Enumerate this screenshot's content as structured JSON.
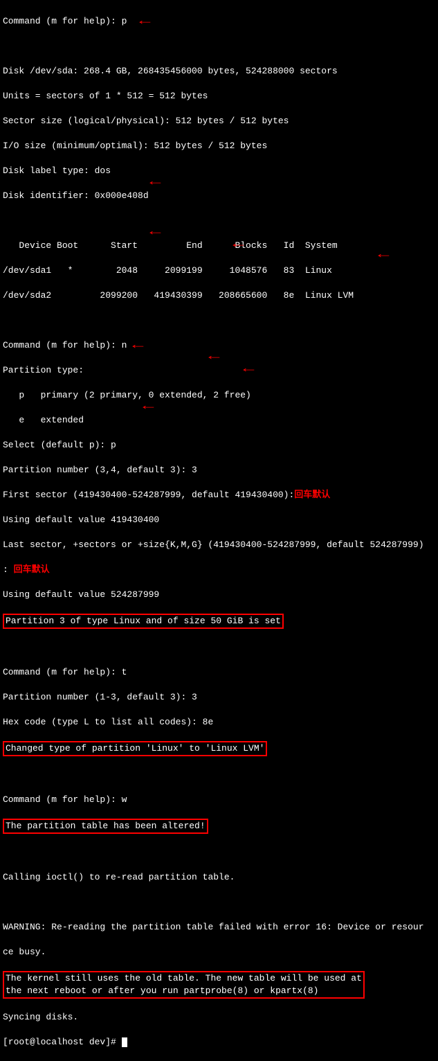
{
  "prompts": {
    "cmd": "Command (m for help): ",
    "root": "[root@localhost dev]# "
  },
  "inputs": {
    "p1": "p",
    "n": "n",
    "select_p": "p",
    "partnum3a": "3",
    "t": "t",
    "partnum3b": "3",
    "hex8e": "8e",
    "w": "w"
  },
  "disk": {
    "header": "Disk /dev/sda: 268.4 GB, 268435456000 bytes, 524288000 sectors",
    "units": "Units = sectors of 1 * 512 = 512 bytes",
    "sector": "Sector size (logical/physical): 512 bytes / 512 bytes",
    "io": "I/O size (minimum/optimal): 512 bytes / 512 bytes",
    "label": "Disk label type: dos",
    "ident": "Disk identifier: 0x000e408d"
  },
  "table": {
    "header": "   Device Boot      Start         End      Blocks   Id  System",
    "row1": "/dev/sda1   *        2048     2099199     1048576   83  Linux",
    "row2": "/dev/sda2         2099200   419430399   208665600   8e  Linux LVM"
  },
  "ptype": {
    "title": "Partition type:",
    "p": "   p   primary (2 primary, 0 extended, 2 free)",
    "e": "   e   extended",
    "select": "Select (default p): ",
    "partnum": "Partition number (3,4, default 3): ",
    "first": "First sector (419430400-524287999, default 419430400):",
    "usedef1": "Using default value 419430400",
    "last": "Last sector, +sectors or +size{K,M,G} (419430400-524287999, default 524287999)",
    "colon": ": ",
    "usedef2": "Using default value 524287999",
    "set": "Partition 3 of type Linux and of size 50 GiB is set"
  },
  "typecmd": {
    "partnum": "Partition number (1-3, default 3): ",
    "hex": "Hex code (type L to list all codes): ",
    "changed": "Changed type of partition 'Linux' to 'Linux LVM'"
  },
  "write": {
    "altered": "The partition table has been altered!",
    "ioctl": "Calling ioctl() to re-read partition table.",
    "warn1": "WARNING: Re-reading the partition table failed with error 16: Device or resour",
    "warn2": "ce busy.",
    "kernel1": "The kernel still uses the old table. The new table will be used at",
    "kernel2": "the next reboot or after you run partprobe(8) or kpartx(8)",
    "sync": "Syncing disks."
  },
  "annotations": {
    "enter_default": "回车默认"
  }
}
